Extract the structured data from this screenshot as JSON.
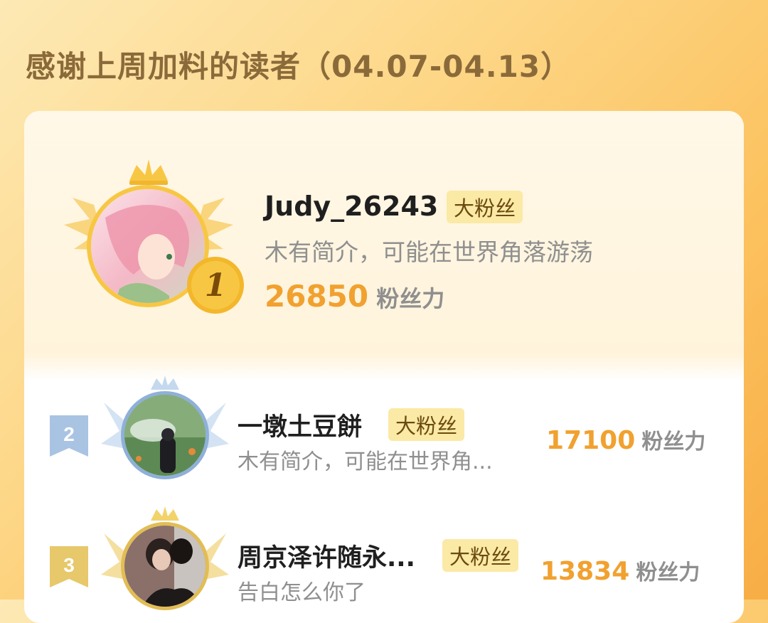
{
  "title": "感谢上周加料的读者（04.07-04.13）",
  "readers": [
    {
      "rank": "1",
      "name": "Judy_26243",
      "badge": "大粉丝",
      "bio": "木有简介，可能在世界角落游荡",
      "points": "26850",
      "points_unit": "粉丝力"
    },
    {
      "rank": "2",
      "name": "一墩土豆餅",
      "badge": "大粉丝",
      "bio": "木有简介，可能在世界角...",
      "points": "17100",
      "points_unit": "粉丝力"
    },
    {
      "rank": "3",
      "name": "周京泽许随永...",
      "badge": "大粉丝",
      "bio": "告白怎么你了",
      "points": "13834",
      "points_unit": "粉丝力"
    }
  ],
  "colors": {
    "gold": "#f1a12f",
    "silver": "#a9c3e3",
    "bronze": "#e7c86a"
  }
}
